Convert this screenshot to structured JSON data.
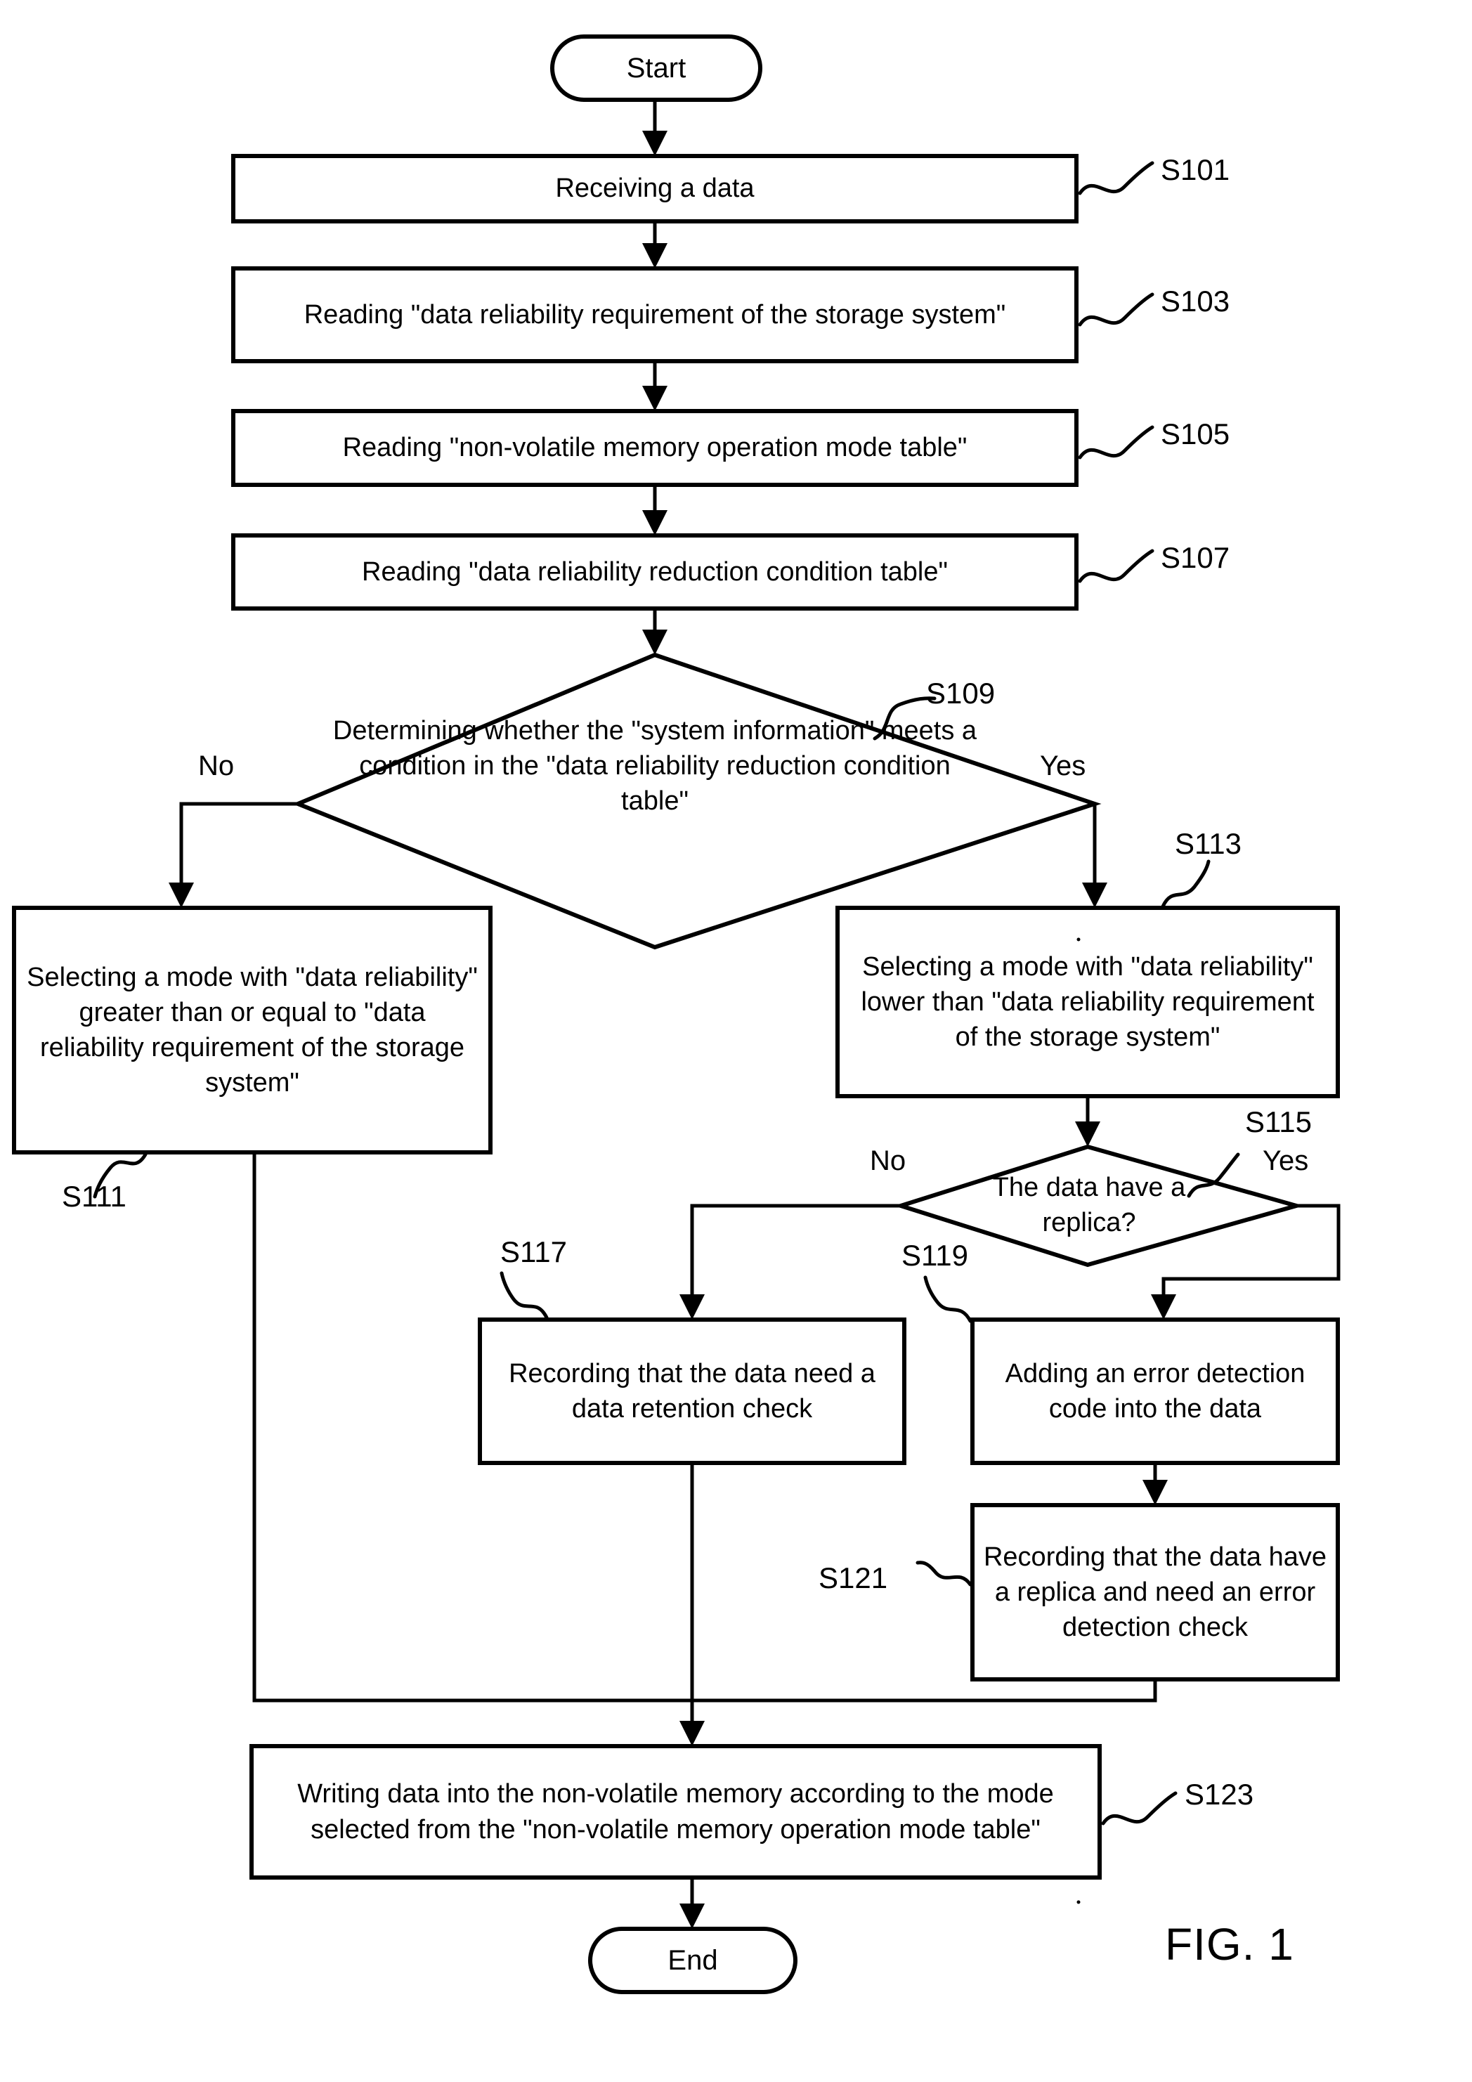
{
  "figure": {
    "caption": "FIG. 1",
    "type": "flowchart"
  },
  "nodes": {
    "start": {
      "label": "Start",
      "shape": "terminal"
    },
    "s101": {
      "label": "Receiving a data",
      "ref": "S101",
      "shape": "process"
    },
    "s103": {
      "label": "Reading \"data reliability requirement of the storage system\"",
      "ref": "S103",
      "shape": "process"
    },
    "s105": {
      "label": "Reading \"non-volatile memory operation mode table\"",
      "ref": "S105",
      "shape": "process"
    },
    "s107": {
      "label": "Reading \"data reliability reduction condition table\"",
      "ref": "S107",
      "shape": "process"
    },
    "s109": {
      "label": "Determining whether the \"system information\" meets a condition in the \"data reliability reduction condition table\"",
      "ref": "S109",
      "shape": "decision"
    },
    "s111": {
      "label": "Selecting a mode with \"data reliability\" greater than or equal to \"data reliability requirement of the storage system\"",
      "ref": "S111",
      "shape": "process"
    },
    "s113": {
      "label": "Selecting a mode with \"data reliability\" lower than \"data reliability requirement of the storage system\"",
      "ref": "S113",
      "shape": "process"
    },
    "s115": {
      "label": "The data have a replica?",
      "ref": "S115",
      "shape": "decision"
    },
    "s117": {
      "label": "Recording that the data need a data retention check",
      "ref": "S117",
      "shape": "process"
    },
    "s119": {
      "label": "Adding an error detection code into the data",
      "ref": "S119",
      "shape": "process"
    },
    "s121": {
      "label": "Recording that the data have a replica and need an error detection check",
      "ref": "S121",
      "shape": "process"
    },
    "s123": {
      "label": "Writing data into the non-volatile memory according to the mode selected  from the \"non-volatile memory operation mode table\"",
      "ref": "S123",
      "shape": "process"
    },
    "end": {
      "label": "End",
      "shape": "terminal"
    }
  },
  "branch_labels": {
    "s109_no": "No",
    "s109_yes": "Yes",
    "s115_no": "No",
    "s115_yes": "Yes"
  },
  "colors": {
    "stroke": "#000000",
    "fill": "#ffffff",
    "text": "#000000"
  }
}
